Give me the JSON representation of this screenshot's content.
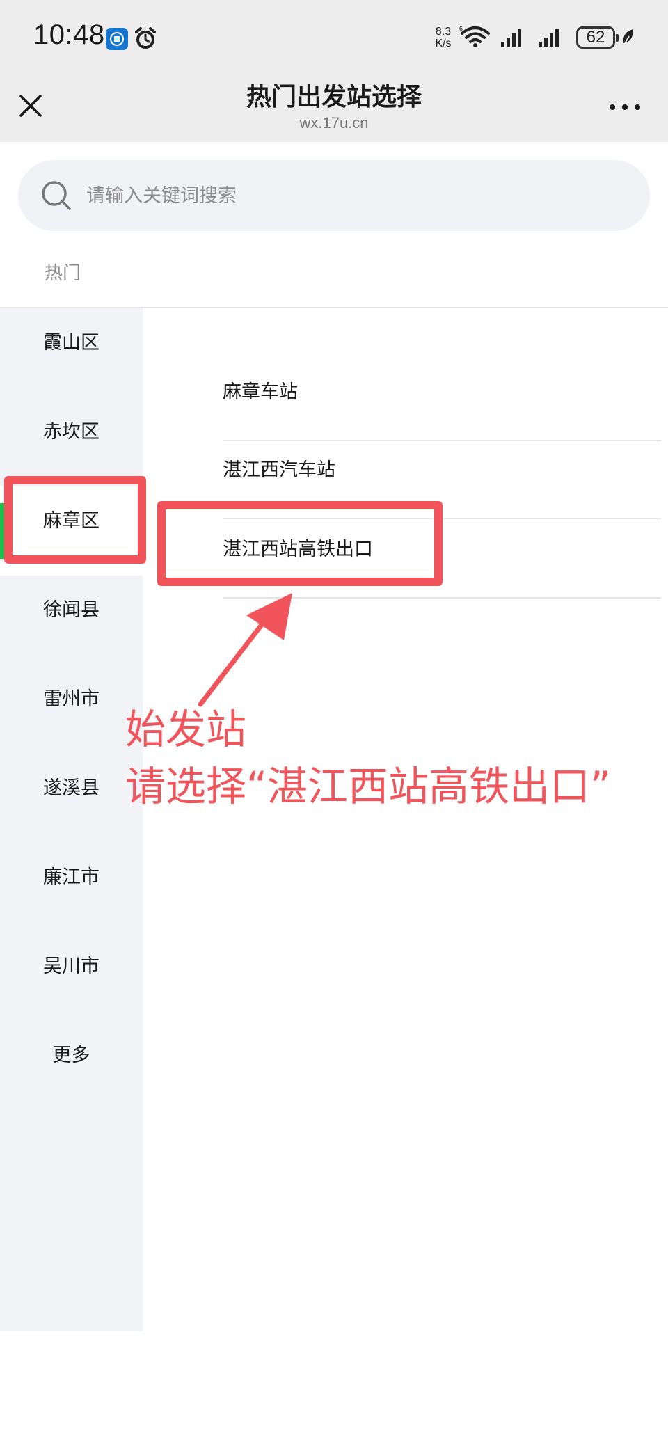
{
  "status_bar": {
    "time": "10:48",
    "net_speed_value": "8.3",
    "net_speed_unit": "K/s",
    "battery": "62",
    "icons": [
      "app-notification-icon",
      "alarm-icon",
      "wifi-icon",
      "signal-icon",
      "signal-icon",
      "battery-icon",
      "leaf-icon"
    ]
  },
  "nav": {
    "title": "热门出发站选择",
    "subtitle": "wx.17u.cn",
    "close_icon": "close-icon",
    "more_icon": "more-icon"
  },
  "search": {
    "placeholder": "请输入关键词搜索",
    "value": "",
    "icon": "search-icon"
  },
  "hot_label": "热门",
  "sidebar": {
    "items": [
      {
        "label": "霞山区",
        "active": false
      },
      {
        "label": "赤坎区",
        "active": false
      },
      {
        "label": "麻章区",
        "active": true
      },
      {
        "label": "徐闻县",
        "active": false
      },
      {
        "label": "雷州市",
        "active": false
      },
      {
        "label": "遂溪县",
        "active": false
      },
      {
        "label": "廉江市",
        "active": false
      },
      {
        "label": "吴川市",
        "active": false
      },
      {
        "label": "更多",
        "active": false
      }
    ]
  },
  "stations": [
    {
      "label": "麻章车站"
    },
    {
      "label": "湛江西汽车站"
    },
    {
      "label": "湛江西站高铁出口"
    }
  ],
  "annotation": {
    "line1": "始发站",
    "line2": "请选择“湛江西站高铁出口”",
    "color": "#f2545b"
  },
  "colors": {
    "header_bg": "#ededed",
    "sidebar_bg": "#f2f3f7",
    "active_indicator": "#1fbf4d",
    "annotation": "#f2545b"
  }
}
